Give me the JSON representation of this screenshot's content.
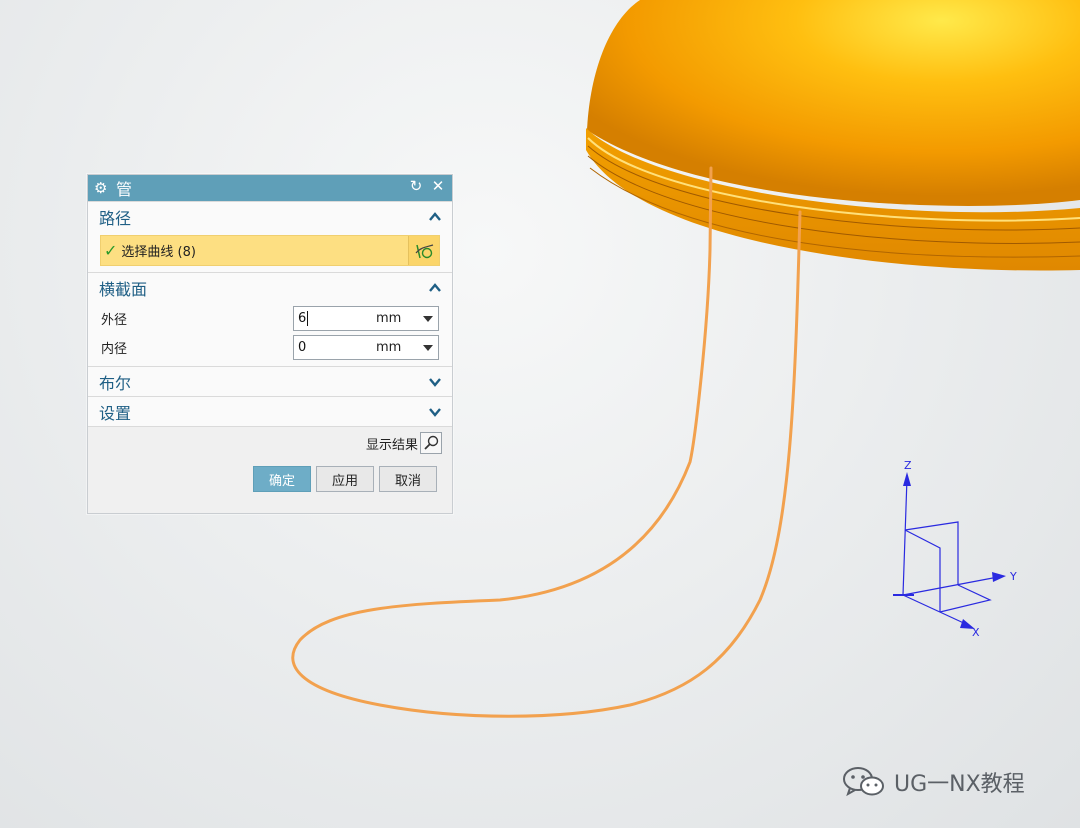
{
  "dialog": {
    "title": "管",
    "path_section": {
      "title": "路径",
      "select_curve_label": "选择曲线 (8)"
    },
    "cross_section": {
      "title": "横截面",
      "outer_diameter": {
        "label": "外径",
        "value": "6",
        "unit": "mm"
      },
      "inner_diameter": {
        "label": "内径",
        "value": "0",
        "unit": "mm"
      }
    },
    "boolean_section": {
      "title": "布尔"
    },
    "settings_section": {
      "title": "设置"
    },
    "show_result_label": "显示结果",
    "buttons": {
      "ok": "确定",
      "apply": "应用",
      "cancel": "取消"
    }
  },
  "triad": {
    "z": "Z",
    "y": "Y",
    "x": "X"
  },
  "watermark": {
    "text": "UG一NX教程"
  },
  "colors": {
    "title_bar": "#5f9fb8",
    "selection_highlight": "#fddf82",
    "dome": "#f7a000",
    "curve": "#f2a14e",
    "triad": "#2222dd"
  },
  "icons": {
    "settings": "gear-icon",
    "reset": "reset-icon",
    "close": "close-icon",
    "collapse": "chevron-up-icon",
    "expand": "chevron-down-icon",
    "selected": "check-icon",
    "curve_select": "curve-select-icon",
    "preview": "magnifier-icon",
    "watermark": "wechat-icon"
  }
}
